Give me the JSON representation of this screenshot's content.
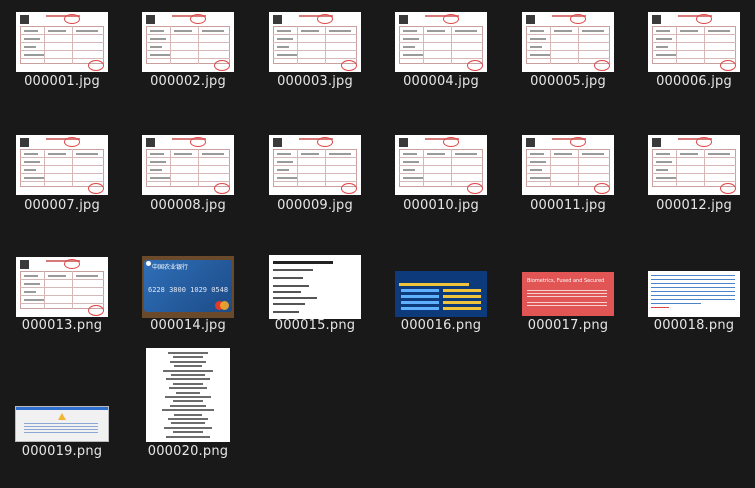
{
  "files": [
    {
      "name": "000001.jpg",
      "kind": "invoice"
    },
    {
      "name": "000002.jpg",
      "kind": "invoice"
    },
    {
      "name": "000003.jpg",
      "kind": "invoice"
    },
    {
      "name": "000004.jpg",
      "kind": "invoice"
    },
    {
      "name": "000005.jpg",
      "kind": "invoice"
    },
    {
      "name": "000006.jpg",
      "kind": "invoice"
    },
    {
      "name": "000007.jpg",
      "kind": "invoice"
    },
    {
      "name": "000008.jpg",
      "kind": "invoice"
    },
    {
      "name": "000009.jpg",
      "kind": "invoice"
    },
    {
      "name": "000010.jpg",
      "kind": "invoice"
    },
    {
      "name": "000011.jpg",
      "kind": "invoice"
    },
    {
      "name": "000012.jpg",
      "kind": "invoice"
    },
    {
      "name": "000013.png",
      "kind": "invoice"
    },
    {
      "name": "000014.jpg",
      "kind": "bank-card"
    },
    {
      "name": "000015.png",
      "kind": "text-document"
    },
    {
      "name": "000016.png",
      "kind": "blue-poster"
    },
    {
      "name": "000017.png",
      "kind": "red-banner"
    },
    {
      "name": "000018.png",
      "kind": "white-text-page"
    },
    {
      "name": "000019.png",
      "kind": "dialog-screenshot"
    },
    {
      "name": "000020.png",
      "kind": "receipt"
    }
  ],
  "thumb_text": {
    "card_bank": "中国农业银行",
    "card_number": "6228 3800 1029 0548",
    "red_title": "Biometrics, Fused and Secured"
  },
  "colors": {
    "background": "#191919",
    "label": "#e6e6e6"
  }
}
